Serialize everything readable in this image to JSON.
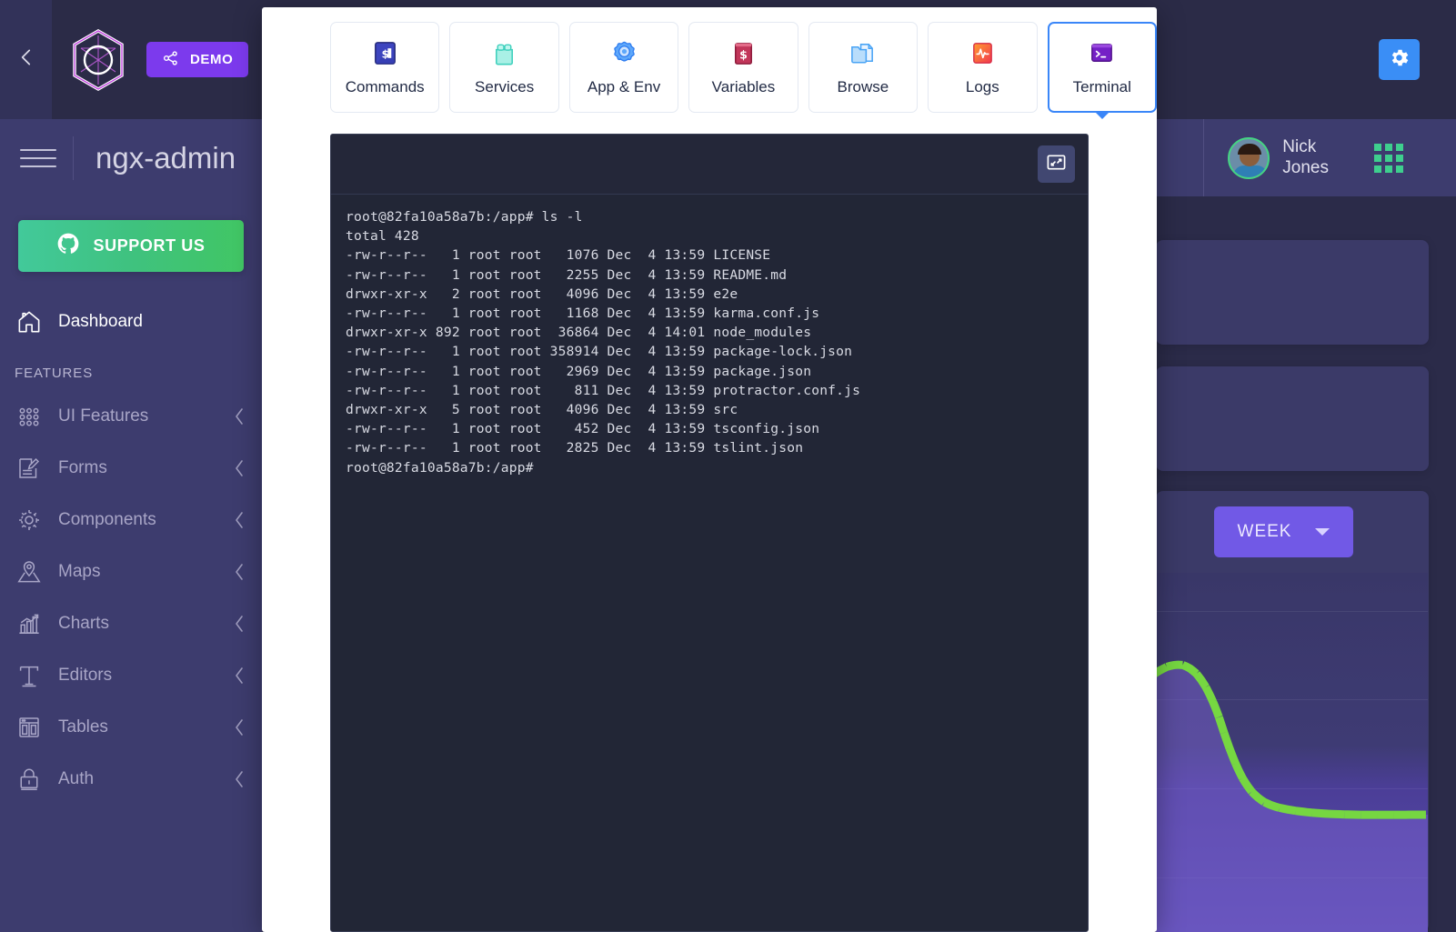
{
  "colors": {
    "accent_blue": "#3a86f8",
    "sidebar_bg": "#3d3c6e",
    "topbar_bg": "#2b2b47",
    "demo_purple": "#7c3aed",
    "support_green": "#41c664",
    "terminal_bg": "#222636",
    "terminal_head": "#242739",
    "week_purple": "#7159e6",
    "chart_line_green": "#76d741"
  },
  "topbar": {
    "collapse_icon": "chevron-left-icon",
    "logo_icon": "hexagon-logo-icon",
    "demo_label": "DEMO",
    "demo_icon": "share-nodes-icon",
    "settings_icon": "gear-icon"
  },
  "header": {
    "menu_icon": "hamburger-icon",
    "title": "ngx-admin",
    "user": {
      "name_line1": "Nick",
      "name_line2": "Jones",
      "avatar_icon": "user-avatar"
    },
    "apps_icon": "grid-apps-icon"
  },
  "sidebar": {
    "support_label": "SUPPORT US",
    "support_icon": "github-icon",
    "section_label": "FEATURES",
    "items": [
      {
        "label": "Dashboard",
        "icon": "home-icon",
        "active": true,
        "expandable": false
      },
      {
        "label": "UI Features",
        "icon": "dots-grid-icon",
        "active": false,
        "expandable": true
      },
      {
        "label": "Forms",
        "icon": "form-edit-icon",
        "active": false,
        "expandable": true
      },
      {
        "label": "Components",
        "icon": "gear-outline-icon",
        "active": false,
        "expandable": true
      },
      {
        "label": "Maps",
        "icon": "map-pin-icon",
        "active": false,
        "expandable": true
      },
      {
        "label": "Charts",
        "icon": "bar-chart-icon",
        "active": false,
        "expandable": true
      },
      {
        "label": "Editors",
        "icon": "text-editor-icon",
        "active": false,
        "expandable": true
      },
      {
        "label": "Tables",
        "icon": "table-icon",
        "active": false,
        "expandable": true
      },
      {
        "label": "Auth",
        "icon": "lock-icon",
        "active": false,
        "expandable": true
      }
    ]
  },
  "background_widgets": {
    "period_select": {
      "value": "WEEK",
      "caret_icon": "chevron-down-icon"
    }
  },
  "modal": {
    "tabs": [
      {
        "label": "Commands",
        "icon": "command-prompt-icon",
        "active": false
      },
      {
        "label": "Services",
        "icon": "services-blocks-icon",
        "active": false
      },
      {
        "label": "App & Env",
        "icon": "app-env-gear-icon",
        "active": false
      },
      {
        "label": "Variables",
        "icon": "variables-icon",
        "active": false
      },
      {
        "label": "Browse",
        "icon": "folder-file-icon",
        "active": false
      },
      {
        "label": "Logs",
        "icon": "logs-pulse-icon",
        "active": false
      },
      {
        "label": "Terminal",
        "icon": "terminal-icon",
        "active": true
      }
    ],
    "terminal": {
      "maximize_icon": "maximize-icon",
      "lines": [
        "root@82fa10a58a7b:/app# ls -l",
        "total 428",
        "-rw-r--r--   1 root root   1076 Dec  4 13:59 LICENSE",
        "-rw-r--r--   1 root root   2255 Dec  4 13:59 README.md",
        "drwxr-xr-x   2 root root   4096 Dec  4 13:59 e2e",
        "-rw-r--r--   1 root root   1168 Dec  4 13:59 karma.conf.js",
        "drwxr-xr-x 892 root root  36864 Dec  4 14:01 node_modules",
        "-rw-r--r--   1 root root 358914 Dec  4 13:59 package-lock.json",
        "-rw-r--r--   1 root root   2969 Dec  4 13:59 package.json",
        "-rw-r--r--   1 root root    811 Dec  4 13:59 protractor.conf.js",
        "drwxr-xr-x   5 root root   4096 Dec  4 13:59 src",
        "-rw-r--r--   1 root root    452 Dec  4 13:59 tsconfig.json",
        "-rw-r--r--   1 root root   2825 Dec  4 13:59 tslint.json",
        "root@82fa10a58a7b:/app#"
      ]
    }
  }
}
